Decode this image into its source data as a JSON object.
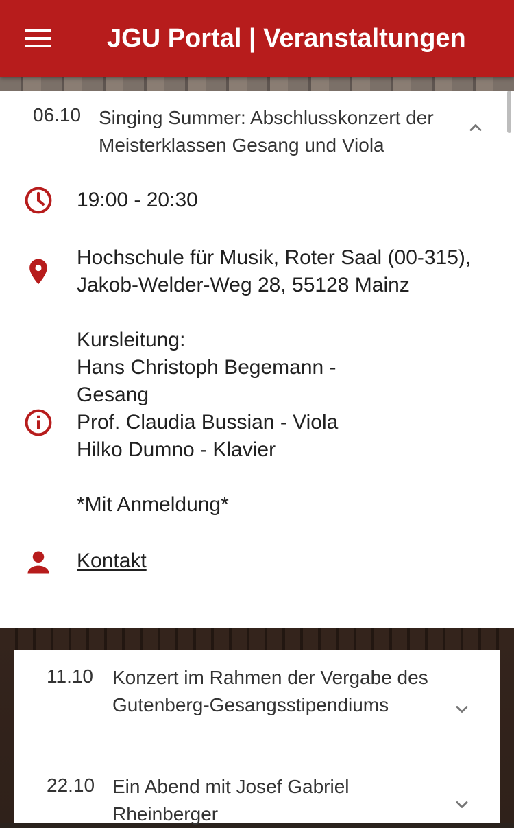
{
  "appbar": {
    "title": "JGU Portal | Veranstaltungen",
    "menu_icon": "hamburger-menu-icon"
  },
  "expanded_event": {
    "date": "06.10",
    "title": "Singing Summer: Abschlusskonzert der Meisterklassen Gesang und Viola",
    "time": "19:00 - 20:30",
    "location": "Hochschule für Musik, Roter Saal (00-315),\nJakob-Welder-Weg 28, 55128 Mainz",
    "info": "Kursleitung:\nHans Christoph Begemann -\nGesang\nProf. Claudia Bussian - Viola\nHilko Dumno - Klavier\n\n*Mit Anmeldung*",
    "contact_label": "Kontakt",
    "icons": [
      "clock-icon",
      "location-pin-icon",
      "info-icon",
      "person-icon"
    ],
    "accent_color": "#b71c1c"
  },
  "event_list": [
    {
      "date": "11.10",
      "title": "Konzert im Rahmen der Vergabe des Gutenberg-Gesangsstipendiums"
    },
    {
      "date": "22.10",
      "title": "Ein Abend mit Josef Gabriel Rheinberger"
    }
  ]
}
